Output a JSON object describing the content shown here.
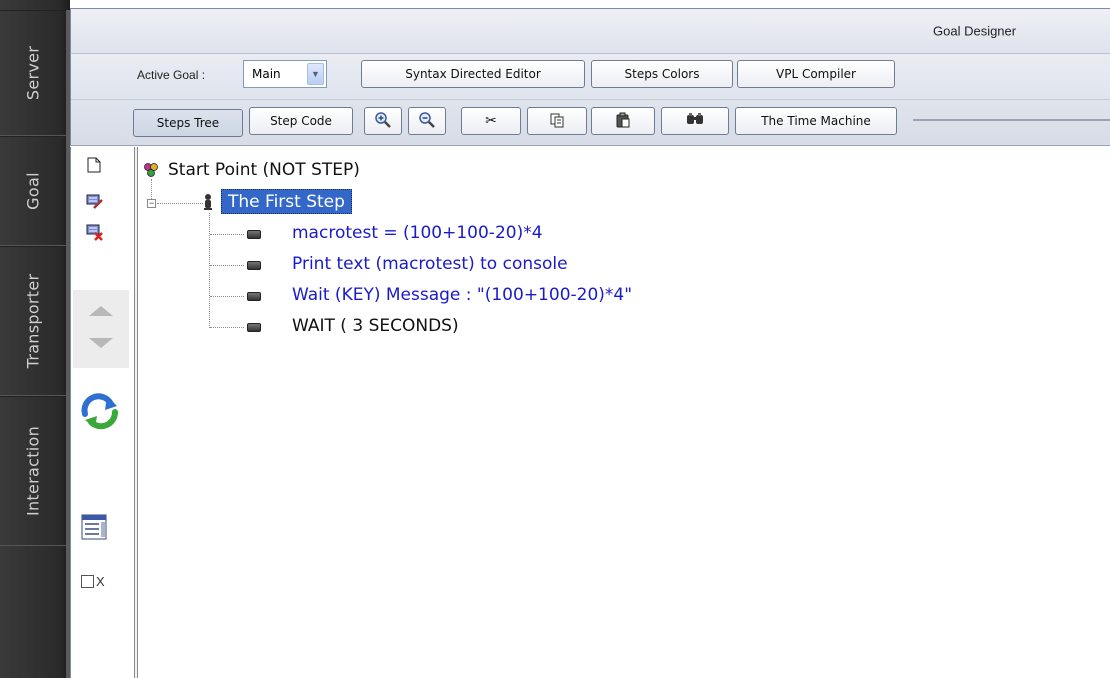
{
  "side_tabs": [
    "Server",
    "Goal",
    "Transporter",
    "Interaction"
  ],
  "window": {
    "title": "Goal Designer"
  },
  "toolbar": {
    "active_goal_label": "Active Goal :",
    "active_goal_value": "Main",
    "syntax_directed_editor": "Syntax Directed Editor",
    "steps_colors": "Steps Colors",
    "vpl_compiler": "VPL Compiler",
    "steps_tree": "Steps Tree",
    "step_code": "Step Code",
    "time_machine": "The Time Machine",
    "icon_buttons": [
      "zoom-in-icon",
      "zoom-out-icon",
      "cut-icon",
      "copy-icon",
      "paste-icon",
      "find-icon"
    ]
  },
  "side_icons": [
    "new-step-icon",
    "edit-step-icon",
    "delete-step-icon",
    "move-up-icon",
    "move-down-icon",
    "refresh-icon",
    "panel-icon"
  ],
  "checkbox": {
    "label": "X"
  },
  "tree": {
    "root": "Start Point (NOT STEP)",
    "step": "The First Step",
    "children": [
      {
        "text": "macrotest = (100+100-20)*4",
        "color": "#1a1acc"
      },
      {
        "text": "Print text (macrotest) to console",
        "color": "#1a1acc"
      },
      {
        "text": "Wait (KEY) Message : \"(100+100-20)*4\"",
        "color": "#1a1acc"
      },
      {
        "text": "WAIT ( 3 SECONDS)",
        "color": "#111111"
      }
    ]
  },
  "colors": {
    "selection": "#3468c8",
    "step_text": "#1a1acc"
  }
}
